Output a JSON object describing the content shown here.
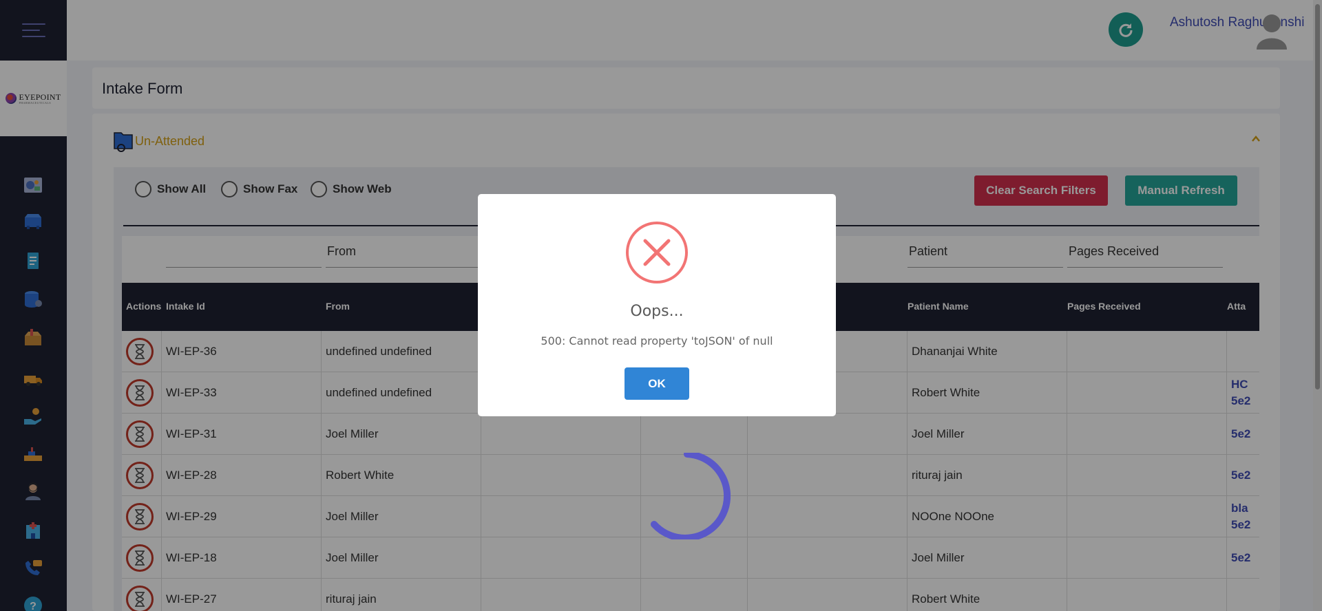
{
  "header": {
    "user_name": "Ashutosh Raghuvanshi"
  },
  "logo": {
    "name": "EYEPOINT",
    "sub": "PHARMACEUTICALS"
  },
  "page": {
    "title": "Intake Form"
  },
  "panel": {
    "label": "Un-Attended"
  },
  "filters": {
    "show_all": "Show All",
    "show_fax": "Show Fax",
    "show_web": "Show Web",
    "clear_button": "Clear Search Filters",
    "refresh_button": "Manual Refresh"
  },
  "search_fields": {
    "from": "From",
    "patient": "Patient",
    "pages": "Pages Received"
  },
  "table": {
    "headers": {
      "actions": "Actions",
      "intake_id": "Intake Id",
      "from": "From",
      "patient_name": "Patient Name",
      "pages_received": "Pages Received",
      "attachments": "Atta"
    },
    "rows": [
      {
        "id": "WI-EP-36",
        "from": "undefined undefined",
        "patient": "Dhananjai White",
        "att1": "",
        "att2": ""
      },
      {
        "id": "WI-EP-33",
        "from": "undefined undefined",
        "patient": "Robert White",
        "att1": "HC",
        "att2": "5e2"
      },
      {
        "id": "WI-EP-31",
        "from": "Joel Miller",
        "patient": "Joel Miller",
        "att1": "5e2",
        "att2": ""
      },
      {
        "id": "WI-EP-28",
        "from": "Robert White",
        "patient": "rituraj jain",
        "att1": "5e2",
        "att2": ""
      },
      {
        "id": "WI-EP-29",
        "from": "Joel Miller",
        "patient": "NOOne NOOne",
        "att1": "bla",
        "att2": "5e2"
      },
      {
        "id": "WI-EP-18",
        "from": "Joel Miller",
        "patient": "Joel Miller",
        "att1": "5e2",
        "att2": ""
      },
      {
        "id": "WI-EP-27",
        "from": "rituraj jain",
        "patient": "Robert White",
        "att1": "",
        "att2": ""
      }
    ]
  },
  "modal": {
    "title": "Oops...",
    "message": "500: Cannot read property 'toJSON' of null",
    "ok_label": "OK"
  },
  "colors": {
    "sidebar": "#1f2233",
    "accent": "#3f4bb5",
    "teal": "#26a69a",
    "danger": "#d32f4d",
    "warning": "#d4a017",
    "modal_button": "#3085d6",
    "error_icon": "#f27474"
  },
  "icons": {
    "menu": "hamburger-menu-icon",
    "refresh": "refresh-icon",
    "avatar": "user-avatar-icon",
    "nav": [
      "dashboard-icon",
      "inbox-icon",
      "document-icon",
      "database-icon",
      "package-icon",
      "truck-icon",
      "hand-coin-icon",
      "delivery-icon",
      "users-icon",
      "hospital-icon",
      "phone-chat-icon",
      "help-icon"
    ]
  }
}
